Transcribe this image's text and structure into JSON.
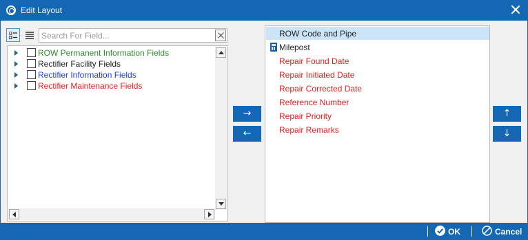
{
  "window": {
    "title": "Edit Layout"
  },
  "search": {
    "placeholder": "Search For Field..."
  },
  "tree": {
    "items": [
      {
        "label": "ROW Permanent Information Fields",
        "color": "#2e8b2e"
      },
      {
        "label": "Rectifier Facility Fields",
        "color": "#222222"
      },
      {
        "label": "Rectifier Information Fields",
        "color": "#1f3fd6"
      },
      {
        "label": "Rectifier Maintenance Fields",
        "color": "#e02020"
      }
    ]
  },
  "selected_fields": {
    "items": [
      {
        "label": "ROW Code and Pipe",
        "color": "#222222",
        "selected": true,
        "icon": ""
      },
      {
        "label": "Milepost",
        "color": "#222222",
        "selected": false,
        "icon": "calculator-icon"
      },
      {
        "label": "Repair Found Date",
        "color": "#e02020",
        "selected": false,
        "icon": ""
      },
      {
        "label": "Repair Initiated Date",
        "color": "#e02020",
        "selected": false,
        "icon": ""
      },
      {
        "label": "Repair Corrected Date",
        "color": "#e02020",
        "selected": false,
        "icon": ""
      },
      {
        "label": "Reference Number",
        "color": "#e02020",
        "selected": false,
        "icon": ""
      },
      {
        "label": "Repair Priority",
        "color": "#e02020",
        "selected": false,
        "icon": ""
      },
      {
        "label": "Repair Remarks",
        "color": "#e02020",
        "selected": false,
        "icon": ""
      }
    ]
  },
  "buttons": {
    "add_arrow": "→",
    "remove_arrow": "←",
    "up_arrow": "↑",
    "down_arrow": "↓",
    "ok": "OK",
    "cancel": "Cancel"
  },
  "colors": {
    "accent": "#1467b3",
    "selection": "#cce4f7"
  }
}
